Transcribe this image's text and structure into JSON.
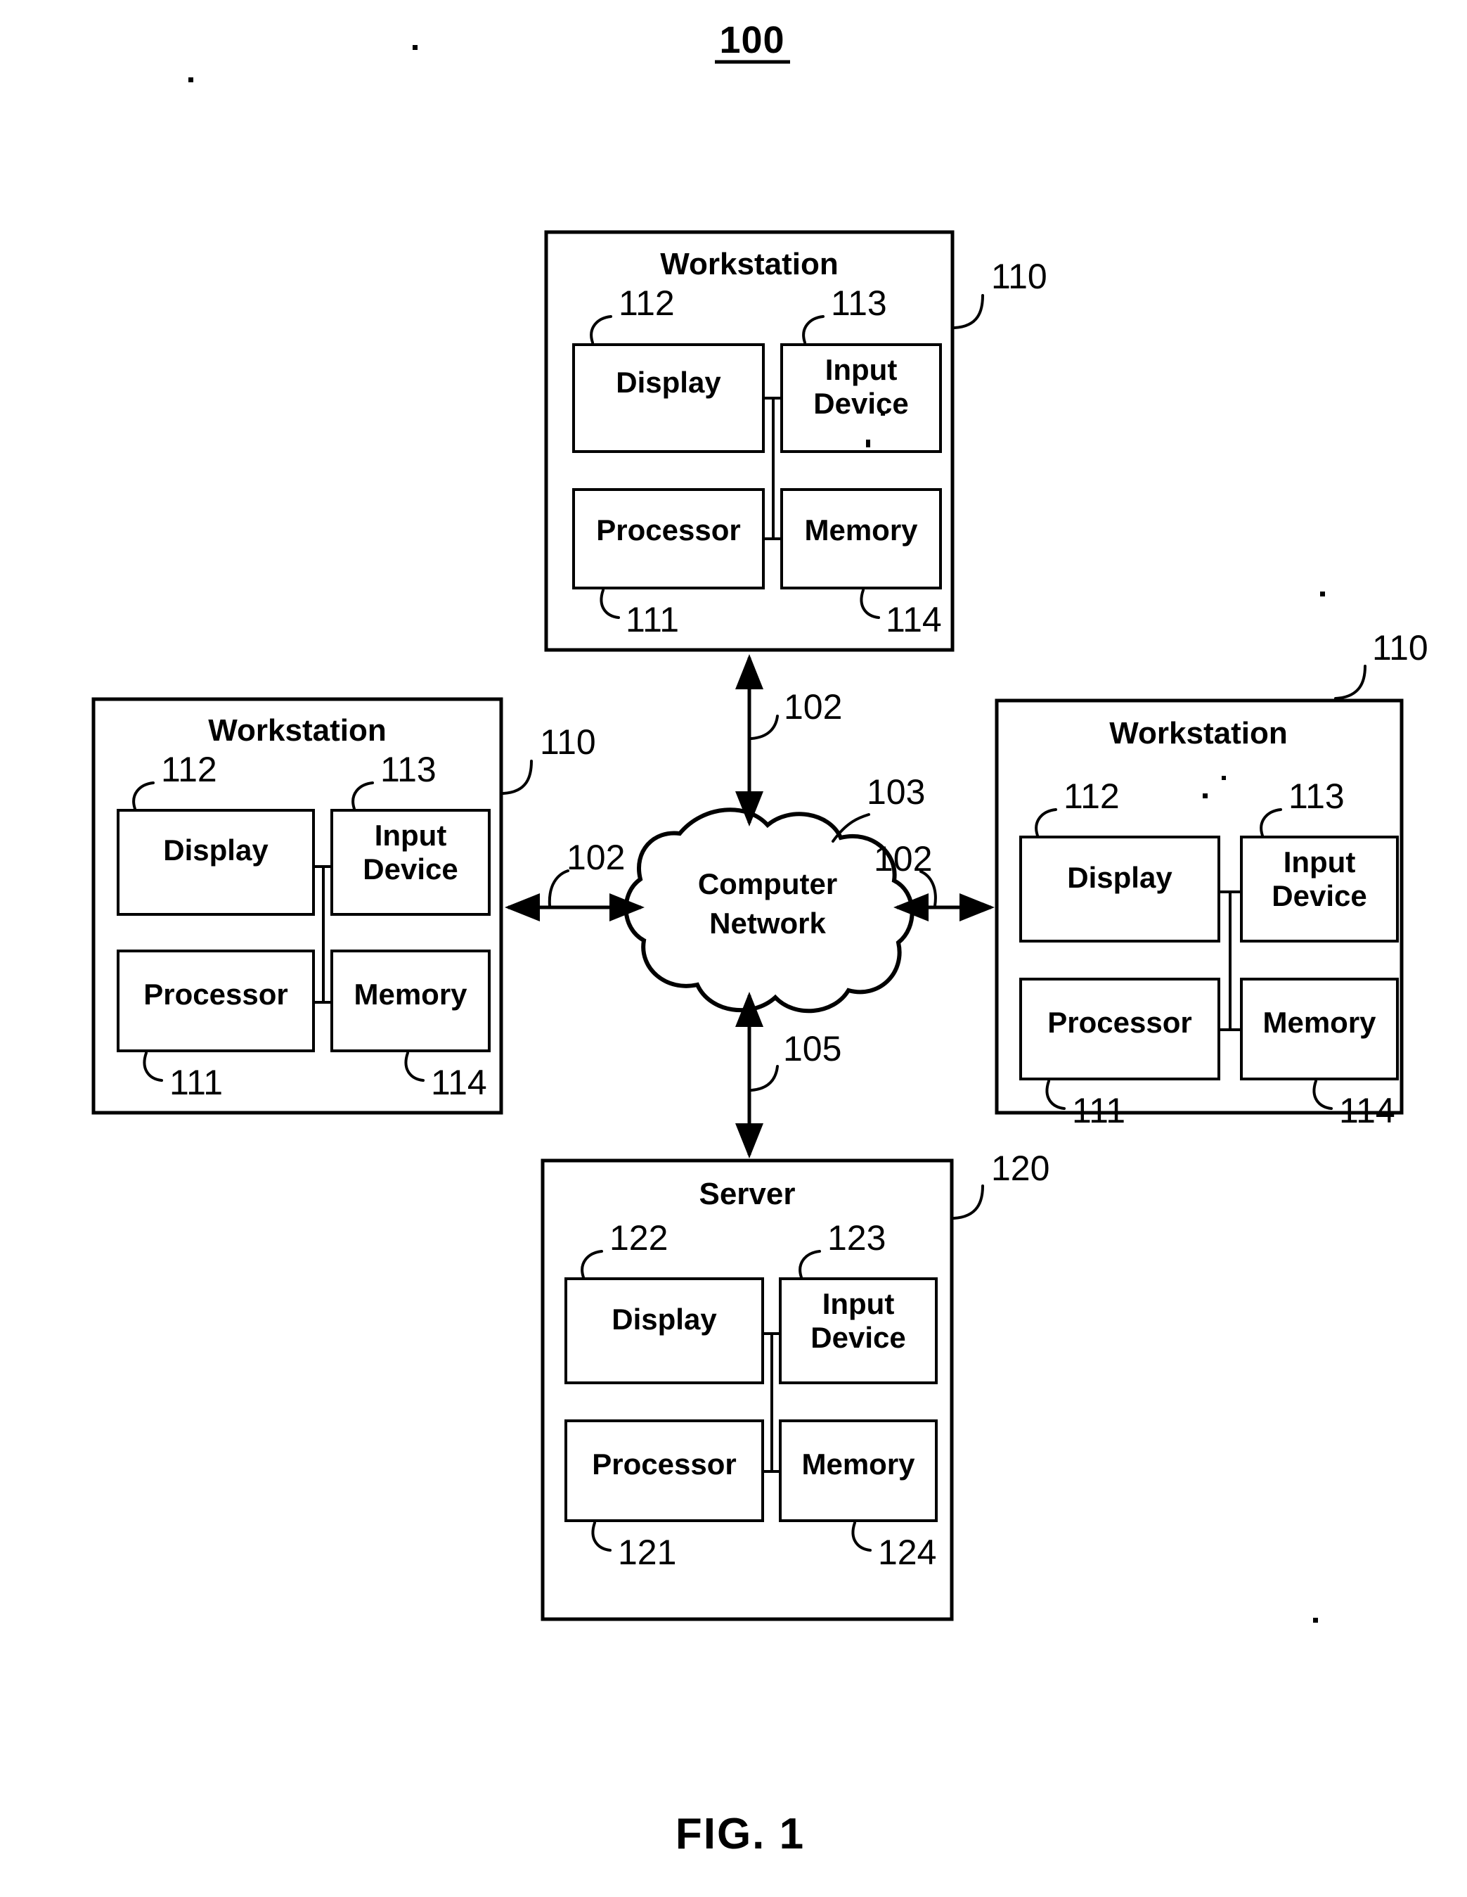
{
  "figure": {
    "system_number": "100",
    "caption": "FIG. 1"
  },
  "nodes": {
    "workstation_top": {
      "title": "Workstation",
      "ref": "110",
      "components": [
        {
          "label": "Display",
          "ref": "112"
        },
        {
          "label": "Input\nDevice",
          "ref": "113"
        },
        {
          "label": "Processor",
          "ref": "111"
        },
        {
          "label": "Memory",
          "ref": "114"
        }
      ]
    },
    "workstation_left": {
      "title": "Workstation",
      "ref": "110",
      "components": [
        {
          "label": "Display",
          "ref": "112"
        },
        {
          "label": "Input\nDevice",
          "ref": "113"
        },
        {
          "label": "Processor",
          "ref": "111"
        },
        {
          "label": "Memory",
          "ref": "114"
        }
      ]
    },
    "workstation_right": {
      "title": "Workstation",
      "ref": "110",
      "components": [
        {
          "label": "Display",
          "ref": "112"
        },
        {
          "label": "Input\nDevice",
          "ref": "113"
        },
        {
          "label": "Processor",
          "ref": "111"
        },
        {
          "label": "Memory",
          "ref": "114"
        }
      ]
    },
    "server_bottom": {
      "title": "Server",
      "ref": "120",
      "components": [
        {
          "label": "Display",
          "ref": "122"
        },
        {
          "label": "Input\nDevice",
          "ref": "123"
        },
        {
          "label": "Processor",
          "ref": "121"
        },
        {
          "label": "Memory",
          "ref": "124"
        }
      ]
    },
    "network": {
      "label_line1": "Computer",
      "label_line2": "Network",
      "ref": "103"
    }
  },
  "links": {
    "top": "102",
    "left": "102",
    "right": "102",
    "bottom": "105"
  },
  "component_text": {
    "display": "Display",
    "input_line1": "Input",
    "input_line2": "Device",
    "processor": "Processor",
    "memory": "Memory"
  },
  "titles": {
    "workstation": "Workstation",
    "server": "Server"
  }
}
